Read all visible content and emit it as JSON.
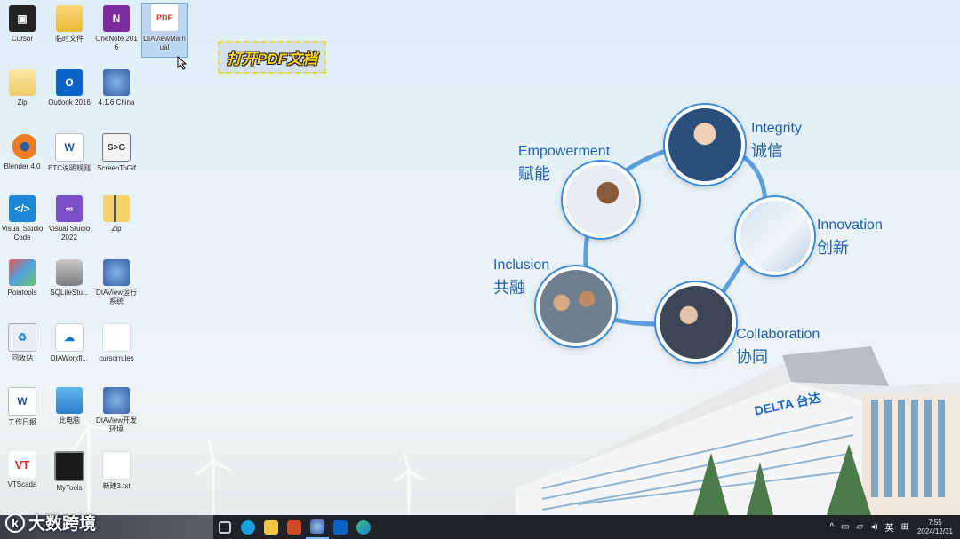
{
  "caption": "打开PDF文档",
  "desktop_icons": [
    {
      "label": "Cursor",
      "icon": "cursor-app-icon"
    },
    {
      "label": "临时文件",
      "icon": "folder-icon"
    },
    {
      "label": "OneNote 2016",
      "icon": "onenote-icon"
    },
    {
      "label": "DIAViewMa nual",
      "icon": "pdf-file-icon"
    },
    {
      "label": "Zip",
      "icon": "folder-icon"
    },
    {
      "label": "Outlook 2016",
      "icon": "outlook-icon"
    },
    {
      "label": "4.1.6 China",
      "icon": "diaview-icon"
    },
    {
      "label": "Blender 4.0",
      "icon": "blender-icon"
    },
    {
      "label": "ETC说明规则",
      "icon": "word-doc-icon"
    },
    {
      "label": "ScreenToGif",
      "icon": "screentogif-icon"
    },
    {
      "label": "Visual Studio Code",
      "icon": "vscode-icon"
    },
    {
      "label": "Visual Studio 2022",
      "icon": "visual-studio-icon"
    },
    {
      "label": "Zip",
      "icon": "zip-icon"
    },
    {
      "label": "Pointools",
      "icon": "pointools-icon"
    },
    {
      "label": "SQLiteStu...",
      "icon": "database-icon"
    },
    {
      "label": "DIAView运行系统",
      "icon": "diaview-icon"
    },
    {
      "label": "回收站",
      "icon": "recycle-bin-icon"
    },
    {
      "label": "DIAWorkfl...",
      "icon": "cloud-chart-icon"
    },
    {
      "label": "cursorrules",
      "icon": "blank-file-icon"
    },
    {
      "label": "工作日报",
      "icon": "word-doc-icon"
    },
    {
      "label": "此电脑",
      "icon": "this-pc-icon"
    },
    {
      "label": "DIAView开发环境",
      "icon": "diaview-icon"
    },
    {
      "label": "VTScada",
      "icon": "vtscada-icon"
    },
    {
      "label": "MyTools",
      "icon": "mytools-icon"
    },
    {
      "label": "新建3.txt",
      "icon": "text-file-icon"
    }
  ],
  "values": [
    {
      "en": "Integrity",
      "cn": "诚信"
    },
    {
      "en": "Empowerment",
      "cn": "赋能"
    },
    {
      "en": "Innovation",
      "cn": "创新"
    },
    {
      "en": "Inclusion",
      "cn": "共融"
    },
    {
      "en": "Collaboration",
      "cn": "协同"
    }
  ],
  "building_sign": "DELTA 台达",
  "watermark": "大数跨境",
  "taskbar": {
    "apps": [
      "task-view-icon",
      "skype-icon",
      "file-explorer-icon",
      "powerpoint-icon",
      "diaview-icon",
      "outlook-icon",
      "edge-icon"
    ],
    "ime": "英",
    "time": "7:55",
    "date": "2024/12/31"
  },
  "colors": {
    "accent": "#2060a8",
    "taskbar": "#1f2328",
    "caption": "#ffd21a"
  }
}
